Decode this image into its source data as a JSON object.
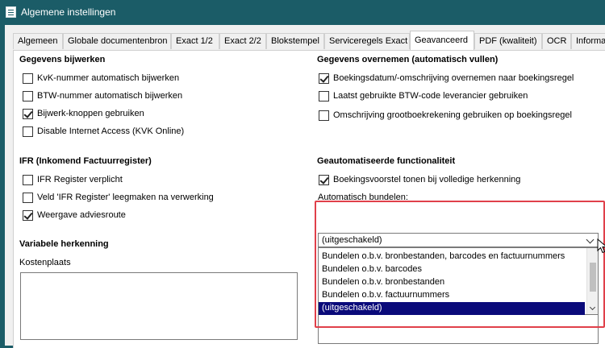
{
  "window": {
    "title": "Algemene instellingen",
    "icon": "settings-document-icon"
  },
  "tabs": [
    {
      "label": "Algemeen",
      "active": false
    },
    {
      "label": "Globale documentenbron",
      "active": false
    },
    {
      "label": "Exact 1/2",
      "active": false
    },
    {
      "label": "Exact 2/2",
      "active": false
    },
    {
      "label": "Blokstempel",
      "active": false
    },
    {
      "label": "Serviceregels Exact",
      "active": false
    },
    {
      "label": "Geavanceerd",
      "active": true
    },
    {
      "label": "PDF (kwaliteit)",
      "active": false
    },
    {
      "label": "OCR",
      "active": false
    },
    {
      "label": "Informati",
      "active": false
    }
  ],
  "gegevens_bijwerken": {
    "heading": "Gegevens bijwerken",
    "items": [
      {
        "label": "KvK-nummer automatisch bijwerken",
        "checked": false
      },
      {
        "label": "BTW-nummer automatisch bijwerken",
        "checked": false
      },
      {
        "label": "Bijwerk-knoppen gebruiken",
        "checked": true
      },
      {
        "label": "Disable Internet Access (KVK Online)",
        "checked": false
      }
    ]
  },
  "ifr": {
    "heading": "IFR (Inkomend Factuurregister)",
    "items": [
      {
        "label": "IFR Register verplicht",
        "checked": false
      },
      {
        "label": "Veld 'IFR Register' leegmaken na verwerking",
        "checked": false
      },
      {
        "label": "Weergave adviesroute",
        "checked": true
      }
    ]
  },
  "variabele_herkenning": {
    "heading": "Variabele herkenning",
    "kostenplaats_label": "Kostenplaats",
    "kostenplaats_value": ""
  },
  "gegevens_overnemen": {
    "heading": "Gegevens overnemen (automatisch vullen)",
    "items": [
      {
        "label": "Boekingsdatum/-omschrijving overnemen naar boekingsregel",
        "checked": true
      },
      {
        "label": "Laatst gebruikte BTW-code leverancier gebruiken",
        "checked": false
      },
      {
        "label": "Omschrijving grootboekrekening gebruiken op boekingsregel",
        "checked": false
      }
    ]
  },
  "geautomatiseerd": {
    "heading": "Geautomatiseerde functionaliteit",
    "items": [
      {
        "label": "Boekingsvoorstel tonen bij volledige herkenning",
        "checked": true
      }
    ],
    "bundelen_label": "Automatisch bundelen:",
    "bundelen_value": "(uitgeschakeld)",
    "bundelen_options": [
      "Bundelen o.b.v. bronbestanden, barcodes en factuurnummers",
      "Bundelen o.b.v. barcodes",
      "Bundelen o.b.v. bronbestanden",
      "Bundelen o.b.v. factuurnummers",
      "(uitgeschakeld)"
    ],
    "bundelen_selected_index": 4
  },
  "colors": {
    "titlebar": "#1b5c67",
    "selection": "#0a0a7a",
    "highlight": "#e0404a"
  }
}
